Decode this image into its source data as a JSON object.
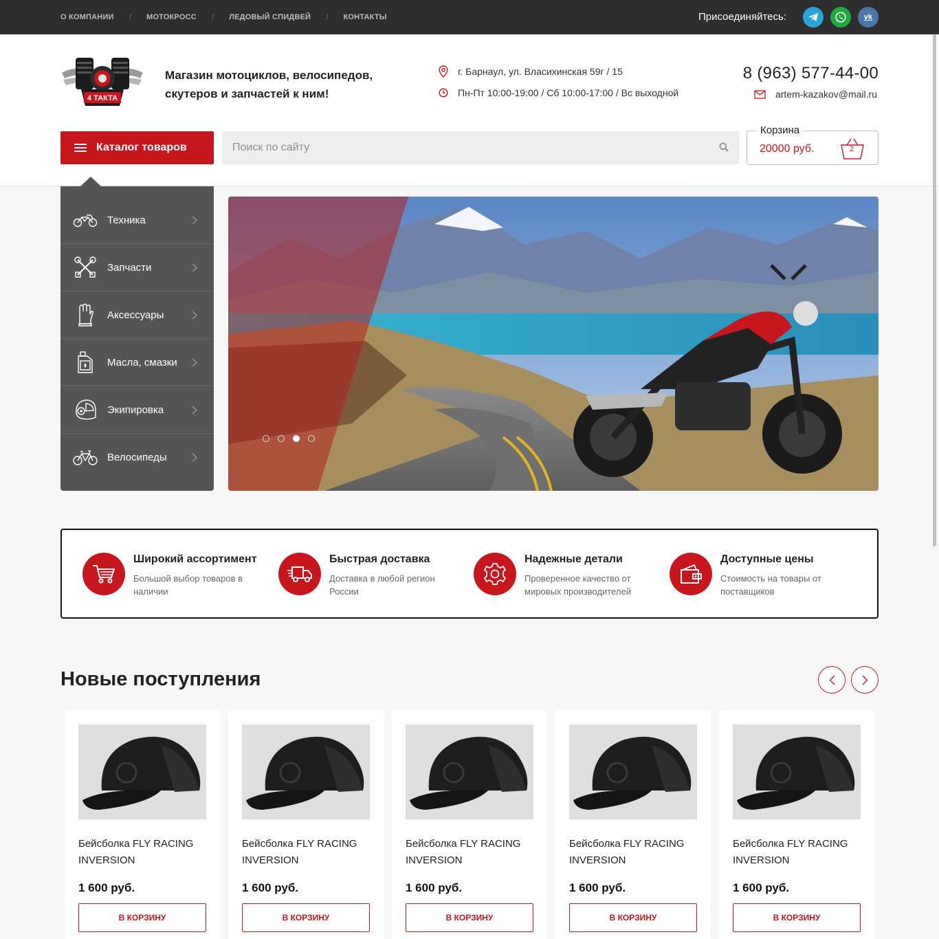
{
  "topnav": {
    "items": [
      {
        "label": "О КОМПАНИИ"
      },
      {
        "label": "МОТОКРОСС"
      },
      {
        "label": "ЛЕДОВЫЙ СПИДВЕЙ"
      },
      {
        "label": "КОНТАКТЫ"
      }
    ],
    "separator": "/",
    "join_label": "Присоединяйтесь:",
    "social": [
      {
        "icon": "telegram-icon",
        "color": "#2aa3dc"
      },
      {
        "icon": "whatsapp-icon",
        "color": "#1faa3d"
      },
      {
        "icon": "vk-icon",
        "label": "vk",
        "color": "#4a76a8"
      }
    ]
  },
  "header": {
    "logo_text": "4 ТАКТА",
    "slogan": "Магазин мотоциклов, велосипедов, скутеров и запчастей к ним!",
    "address": "г. Барнаул, ул. Власихинская 59г / 15",
    "hours": "Пн-Пт 10:00-19:00 / Сб 10:00-17:00 / Вс выходной",
    "phone": "8 (963) 577-44-00",
    "email": "artem-kazakov@mail.ru"
  },
  "catalog_button": {
    "label": "Каталог товаров"
  },
  "search": {
    "placeholder": "Поиск по сайту",
    "value": ""
  },
  "cart": {
    "label": "Корзина",
    "sum": "20000 руб.",
    "count": "2"
  },
  "sidemenu": {
    "items": [
      {
        "label": "Техника",
        "icon": "motorcycle-icon"
      },
      {
        "label": "Запчасти",
        "icon": "tools-icon"
      },
      {
        "label": "Аксессуары",
        "icon": "glove-icon"
      },
      {
        "label": "Масла, смазки",
        "icon": "oil-can-icon"
      },
      {
        "label": "Экипировка",
        "icon": "helmet-icon"
      },
      {
        "label": "Велосипеды",
        "icon": "bicycle-icon"
      }
    ]
  },
  "slider": {
    "slides_total": 4,
    "active_slide": 3
  },
  "features": [
    {
      "title": "Широкий ассортимент",
      "desc": "Большой выбор товаров в наличии",
      "icon": "cart-icon"
    },
    {
      "title": "Быстрая доставка",
      "desc": "Доставка в любой регион России",
      "icon": "truck-icon"
    },
    {
      "title": "Надежные детали",
      "desc": "Проверенное качество от мировых производителей",
      "icon": "gear-icon"
    },
    {
      "title": "Доступные цены",
      "desc": "Стоимость на товары от поставщиков",
      "icon": "wallet-icon"
    }
  ],
  "new_arrivals": {
    "title": "Новые поступления",
    "products": [
      {
        "name": "Бейсболка FLY RACING INVERSION",
        "price": "1 600 руб.",
        "button": "В КОРЗИНУ"
      },
      {
        "name": "Бейсболка FLY RACING INVERSION",
        "price": "1 600 руб.",
        "button": "В КОРЗИНУ"
      },
      {
        "name": "Бейсболка FLY RACING INVERSION",
        "price": "1 600 руб.",
        "button": "В КОРЗИНУ"
      },
      {
        "name": "Бейсболка FLY RACING INVERSION",
        "price": "1 600 руб.",
        "button": "В КОРЗИНУ"
      },
      {
        "name": "Бейсболка FLY RACING INVERSION",
        "price": "1 600 руб.",
        "button": "В КОРЗИНУ"
      }
    ]
  },
  "colors": {
    "accent": "#c8161d",
    "topbar": "#2d2d2d",
    "menu": "#555555"
  }
}
